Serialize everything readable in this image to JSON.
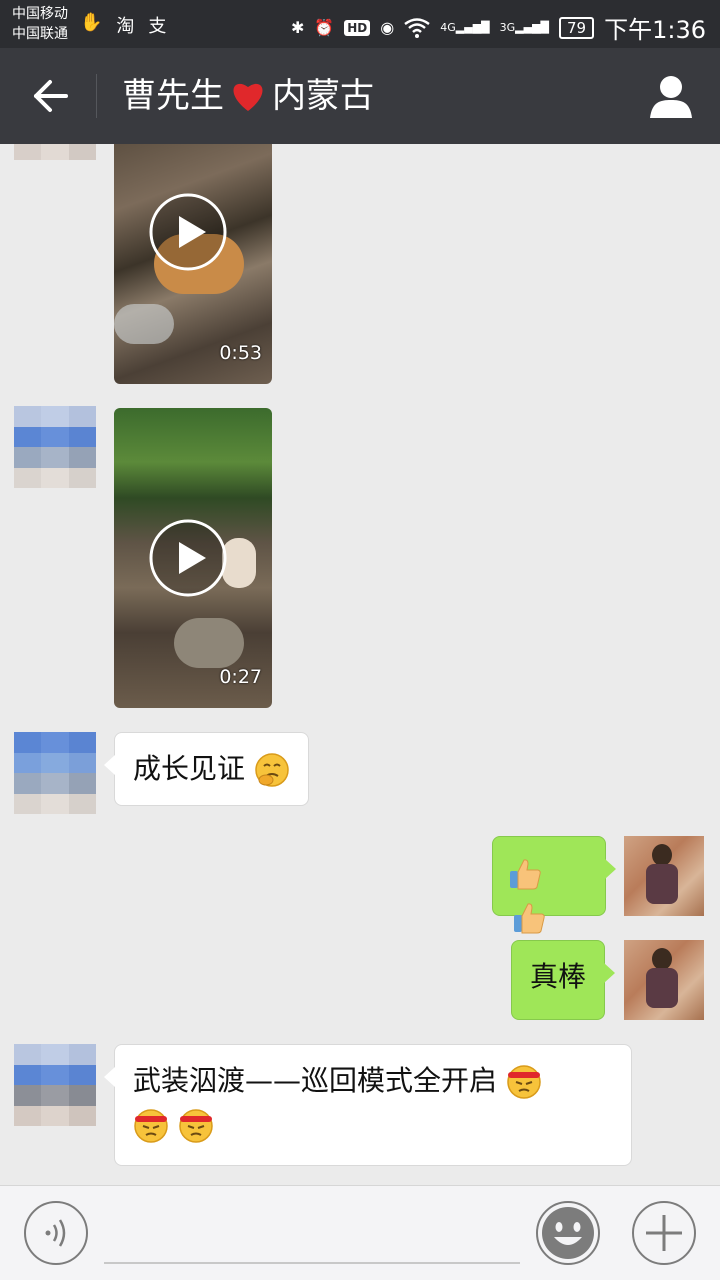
{
  "status_bar": {
    "carrier_1": "中国移动",
    "carrier_2": "中国联通",
    "app_icon_1": "淘",
    "app_icon_2": "支",
    "hd_label": "HD",
    "network_1": "4G",
    "network_2": "3G",
    "battery": "79",
    "time": "下午1:36"
  },
  "header": {
    "title_part1": "曹先生",
    "title_part2": "内蒙古",
    "title_heart": "❤",
    "back_icon": "back-arrow-icon",
    "profile_icon": "person-icon"
  },
  "messages": [
    {
      "type": "video",
      "sender": "other",
      "duration": "0:53"
    },
    {
      "type": "video",
      "sender": "other",
      "duration": "0:27"
    },
    {
      "type": "text",
      "sender": "other",
      "text": "成长见证"
    },
    {
      "type": "emoji",
      "sender": "self",
      "emoji": "thumbs-up x2"
    },
    {
      "type": "text",
      "sender": "self",
      "text": "真棒"
    },
    {
      "type": "text",
      "sender": "other",
      "text": "武装泅渡——巡回模式全开启"
    }
  ],
  "colors": {
    "title_bar": "#393a3f",
    "status_bar": "#2c2d31",
    "chat_bg": "#ebebeb",
    "self_bubble": "#9fe658",
    "other_bubble": "#ffffff"
  }
}
